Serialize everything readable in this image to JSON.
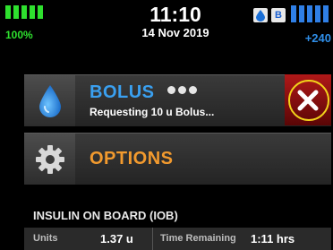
{
  "status": {
    "battery_label": "100%",
    "time": "11:10",
    "date": "14 Nov 2019",
    "badge_b": "B",
    "insulin_label": "+240",
    "battery_segments": 5,
    "insulin_segments": 5,
    "colors": {
      "battery": "#2ee02e",
      "insulin": "#2f7fe6"
    }
  },
  "bolus": {
    "title": "BOLUS",
    "status": "Requesting 10 u Bolus...",
    "icon": "insulin-drop-icon",
    "cancel_icon": "close-icon",
    "colors": {
      "title": "#3aa0f0",
      "cancel_bg": "#b01818",
      "highlight_ring": "#f2d21a"
    }
  },
  "options": {
    "label": "OPTIONS",
    "icon": "gear-icon",
    "colors": {
      "label": "#f29a2e"
    }
  },
  "iob": {
    "header": "INSULIN ON BOARD (IOB)",
    "units_label": "Units",
    "units_value": "1.37 u",
    "time_label": "Time Remaining",
    "time_value": "1:11 hrs"
  }
}
